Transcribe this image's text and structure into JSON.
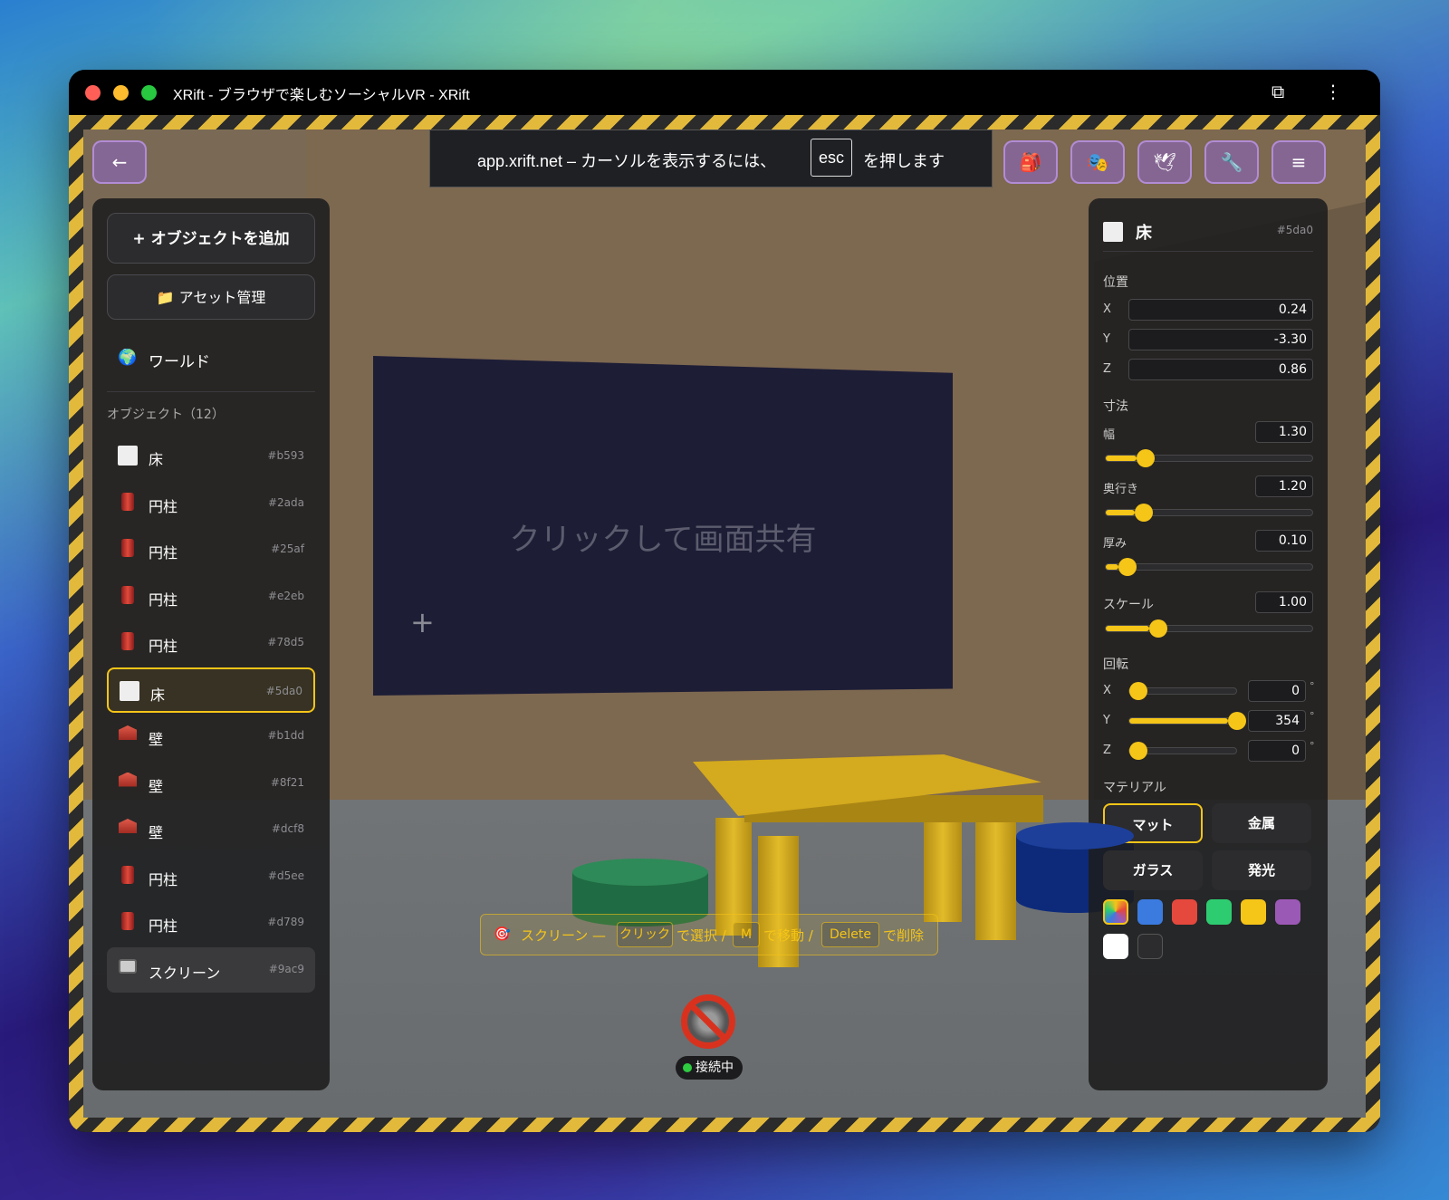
{
  "window": {
    "title": "XRift - ブラウザで楽しむソーシャルVR - XRift"
  },
  "banner": {
    "prefix": "app.xrift.net – カーソルを表示するには、",
    "key": "esc",
    "suffix": "を押します"
  },
  "toolbar": {
    "back_label": "←",
    "menu_label": "≡"
  },
  "left_panel": {
    "add_button": "+ オブジェクトを追加",
    "asset_button": "アセット管理",
    "world_label": "ワールド",
    "objects_header": "オブジェクト（12）",
    "objects": [
      {
        "icon": "white-box-icon",
        "name": "床",
        "id": "#b593"
      },
      {
        "icon": "cylinder-icon",
        "name": "円柱",
        "id": "#2ada"
      },
      {
        "icon": "cylinder-icon",
        "name": "円柱",
        "id": "#25af"
      },
      {
        "icon": "cylinder-icon",
        "name": "円柱",
        "id": "#e2eb"
      },
      {
        "icon": "cylinder-icon",
        "name": "円柱",
        "id": "#78d5"
      },
      {
        "icon": "white-box-icon",
        "name": "床",
        "id": "#5da0",
        "selected": true
      },
      {
        "icon": "wall-icon",
        "name": "壁",
        "id": "#b1dd"
      },
      {
        "icon": "wall-icon",
        "name": "壁",
        "id": "#8f21"
      },
      {
        "icon": "wall-icon",
        "name": "壁",
        "id": "#dcf8"
      },
      {
        "icon": "cylinder-icon",
        "name": "円柱",
        "id": "#d5ee"
      },
      {
        "icon": "cylinder-icon",
        "name": "円柱",
        "id": "#d789"
      },
      {
        "icon": "tv-icon",
        "name": "スクリーン",
        "id": "#9ac9"
      }
    ]
  },
  "right_panel": {
    "title": "床",
    "id": "#5da0",
    "position_label": "位置",
    "position": {
      "x_label": "X",
      "x": "0.24",
      "y_label": "Y",
      "y": "-3.30",
      "z_label": "Z",
      "z": "0.86"
    },
    "dimensions_label": "寸法",
    "width_label": "幅",
    "width": "1.30",
    "width_fraction": 0.15,
    "depth_label": "奥行き",
    "depth": "1.20",
    "depth_fraction": 0.14,
    "thickness_label": "厚み",
    "thickness": "0.10",
    "thickness_fraction": 0.06,
    "scale_label": "スケール",
    "scale": "1.00",
    "scale_fraction": 0.21,
    "rotation_label": "回転",
    "rotation": {
      "x_label": "X",
      "x": "0",
      "x_fraction": 0.0,
      "y_label": "Y",
      "y": "354",
      "y_fraction": 0.92,
      "z_label": "Z",
      "z": "0",
      "z_fraction": 0.0,
      "unit": "°"
    },
    "material_label": "マテリアル",
    "materials": [
      "マット",
      "金属",
      "ガラス",
      "発光"
    ],
    "active_material": "マット",
    "colors": [
      "#3b7be0",
      "#e5483d",
      "#2ecc71",
      "#f5c518",
      "#9b59b6",
      "#ffffff",
      "#2c2c2e"
    ]
  },
  "scene": {
    "screen_prompt": "クリックして画面共有"
  },
  "hint": {
    "part1": "スクリーン —",
    "key1": "クリック",
    "part2": "で選択 /",
    "key2": "M",
    "part3": "で移動 /",
    "key3": "Delete",
    "part4": "で削除"
  },
  "status": {
    "label": "接続中",
    "color": "#2ecc40"
  }
}
